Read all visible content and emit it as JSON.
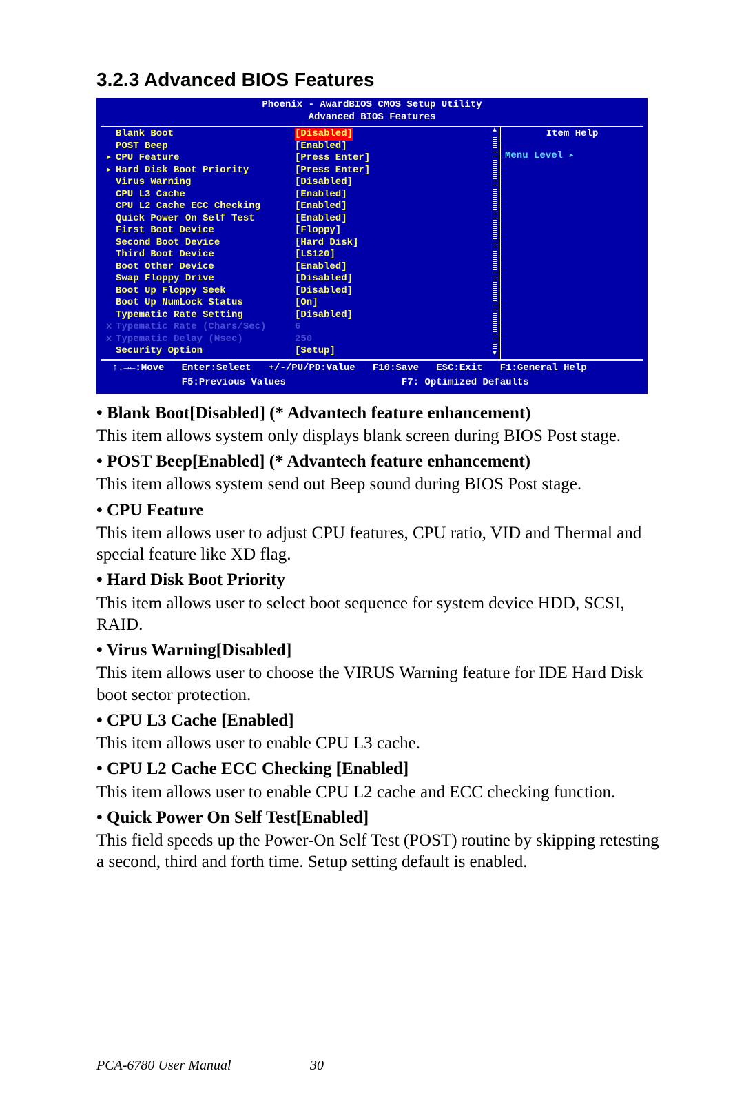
{
  "heading": "3.2.3 Advanced BIOS Features",
  "bios": {
    "title": "Phoenix - AwardBIOS CMOS Setup Utility",
    "subtitle": "Advanced BIOS Features",
    "rows": [
      {
        "arrow": " ",
        "name": "Blank Boot",
        "value": "[Disabled]",
        "selected": true
      },
      {
        "arrow": " ",
        "name": "POST Beep",
        "value": "[Enabled]"
      },
      {
        "arrow": "▸",
        "name": "CPU Feature",
        "value": "[Press Enter]"
      },
      {
        "arrow": "▸",
        "name": "Hard Disk Boot Priority",
        "value": "[Press Enter]"
      },
      {
        "arrow": " ",
        "name": "Virus Warning",
        "value": "[Disabled]"
      },
      {
        "arrow": " ",
        "name": "CPU L3 Cache",
        "value": "[Enabled]"
      },
      {
        "arrow": " ",
        "name": "CPU L2 Cache ECC Checking",
        "value": "[Enabled]"
      },
      {
        "arrow": " ",
        "name": "Quick Power On Self Test",
        "value": "[Enabled]"
      },
      {
        "arrow": " ",
        "name": "First Boot Device",
        "value": "[Floppy]"
      },
      {
        "arrow": " ",
        "name": "Second Boot Device",
        "value": "[Hard Disk]"
      },
      {
        "arrow": " ",
        "name": "Third Boot Device",
        "value": "[LS120]"
      },
      {
        "arrow": " ",
        "name": "Boot Other Device",
        "value": "[Enabled]"
      },
      {
        "arrow": " ",
        "name": "Swap Floppy Drive",
        "value": "[Disabled]"
      },
      {
        "arrow": " ",
        "name": "Boot Up Floppy Seek",
        "value": "[Disabled]"
      },
      {
        "arrow": " ",
        "name": "Boot Up NumLock Status",
        "value": "[On]"
      },
      {
        "arrow": " ",
        "name": "Typematic Rate Setting",
        "value": "[Disabled]"
      },
      {
        "arrow": "x",
        "name": "Typematic Rate (Chars/Sec)",
        "value": "6",
        "disabled": true
      },
      {
        "arrow": "x",
        "name": "Typematic Delay (Msec)",
        "value": "250",
        "disabled": true
      },
      {
        "arrow": " ",
        "name": "Security Option",
        "value": "[Setup]"
      }
    ],
    "help_title": "Item Help",
    "help_level": "Menu Level   ▸",
    "footer1": "  ↑↓→←:Move   Enter:Select   +/-/PU/PD:Value   F10:Save   ESC:Exit   F1:General Help",
    "footer2": "              F5:Previous Values                    F7: Optimized Defaults"
  },
  "items": [
    {
      "hdr": "•  Blank Boot[Disabled] (* Advantech feature enhancement)",
      "body": "This item allows system only displays blank screen during BIOS Post stage."
    },
    {
      "hdr": "•  POST Beep[Enabled] (* Advantech feature enhancement)",
      "body": "This item allows system send out Beep sound during BIOS Post stage."
    },
    {
      "hdr": "•  CPU Feature",
      "body": "This item allows user to adjust CPU features, CPU ratio, VID and Thermal and special feature like XD flag."
    },
    {
      "hdr": "•  Hard Disk Boot Priority",
      "body": "This item allows user to select boot sequence for system device HDD, SCSI, RAID."
    },
    {
      "hdr": "•  Virus Warning[Disabled]",
      "body": "This item allows user to choose the VIRUS Warning feature for IDE Hard Disk boot sector protection."
    },
    {
      "hdr": "•  CPU L3 Cache [Enabled]",
      "body": "This item allows user to enable CPU L3 cache."
    },
    {
      "hdr": "•  CPU L2 Cache ECC Checking [Enabled]",
      "body": "This item allows user to enable CPU L2 cache and ECC checking function."
    },
    {
      "hdr": "•  Quick Power On Self Test[Enabled]",
      "body": "This field speeds up the Power-On Self Test (POST) routine by skipping retesting a second, third and forth time. Setup setting default is enabled."
    }
  ],
  "footer_left": "PCA-6780 User Manual",
  "footer_page": "30"
}
